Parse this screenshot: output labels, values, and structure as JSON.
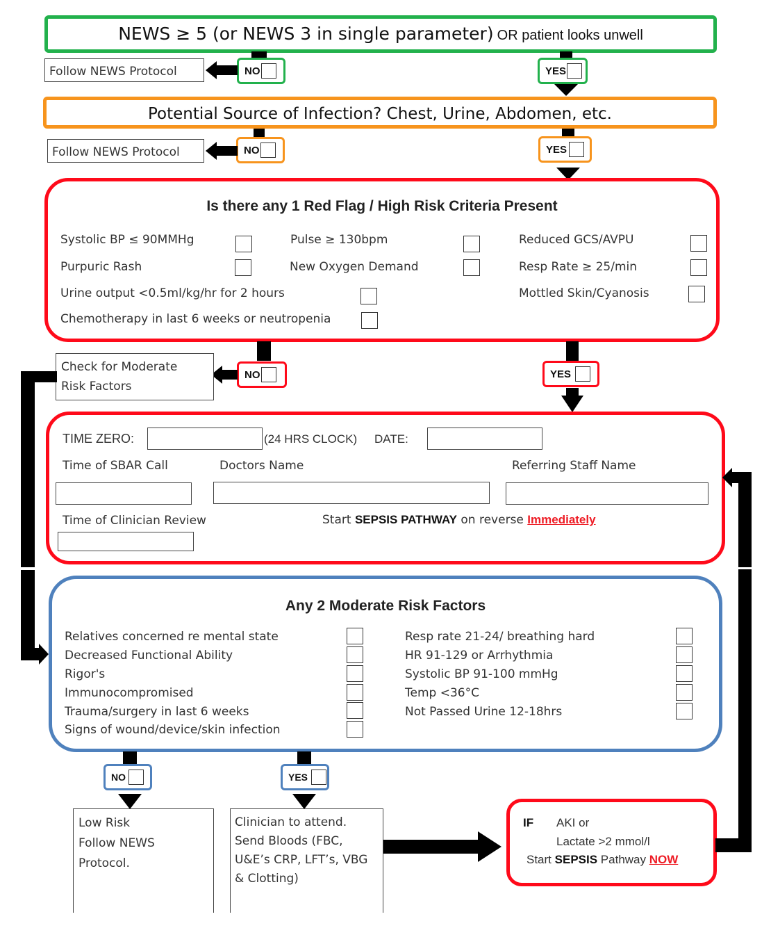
{
  "step1": {
    "title_main": "NEWS ≥ 5 (or NEWS 3 in single parameter)",
    "title_suffix": "OR patient looks unwell",
    "no_label": "NO",
    "yes_label": "YES",
    "no_action": "Follow NEWS Protocol"
  },
  "step2": {
    "title": "Potential Source of Infection? Chest, Urine, Abdomen, etc.",
    "no_label": "NO",
    "yes_label": "YES",
    "no_action": "Follow NEWS Protocol"
  },
  "red_flag": {
    "title": "Is there any 1 Red Flag / High Risk Criteria Present",
    "criteria": [
      "Systolic BP ≤ 90MMHg",
      "Pulse ≥ 130bpm",
      "Reduced GCS/AVPU",
      "Purpuric Rash",
      "New Oxygen Demand",
      "Resp Rate ≥ 25/min",
      "Urine output <0.5ml/kg/hr for 2 hours",
      "Mottled Skin/Cyanosis",
      "Chemotherapy in last 6 weeks or neutropenia"
    ],
    "no_label": "NO",
    "yes_label": "YES",
    "no_action_line1": "Check for Moderate",
    "no_action_line2": "Risk Factors"
  },
  "time_zero": {
    "time_zero_label": "TIME ZERO:",
    "clock_note": "(24 HRS CLOCK)",
    "date_label": "DATE:",
    "sbar_label": "Time of SBAR Call",
    "doctors_label": "Doctors Name",
    "referring_label": "Referring Staff Name",
    "clinician_review_label": "Time of Clinician Review",
    "start_prefix": "Start",
    "start_bold": "SEPSIS PATHWAY",
    "start_mid": "on reverse",
    "start_emphasis": "Immediately",
    "values": {
      "time_zero": "",
      "date": "",
      "sbar_time": "",
      "doctors_name": "",
      "referring_staff": "",
      "clinician_review_time": ""
    }
  },
  "moderate": {
    "title": "Any 2 Moderate Risk Factors",
    "left_factors": [
      "Relatives concerned re mental state",
      "Decreased Functional Ability",
      "Rigor's",
      "Immunocompromised",
      "Trauma/surgery in last 6 weeks",
      "Signs of wound/device/skin infection"
    ],
    "right_factors": [
      "Resp rate 21-24/ breathing hard",
      "HR 91-129 or Arrhythmia",
      "Systolic BP 91-100 mmHg",
      "Temp <36°C",
      "Not Passed Urine 12-18hrs"
    ],
    "no_label": "NO",
    "yes_label": "YES"
  },
  "low_risk": {
    "lines": [
      "Low Risk",
      "Follow NEWS",
      "Protocol."
    ]
  },
  "clinician": {
    "lines": [
      "Clinician to attend.",
      "Send Bloods (FBC,",
      "U&E’s CRP, LFT’s, VBG",
      "& Clotting)"
    ]
  },
  "if_box": {
    "if_label": "IF",
    "cond1": "AKI or",
    "cond2": "Lactate >2 mmol/l",
    "start_prefix": "Start",
    "start_bold": "SEPSIS",
    "start_mid": "Pathway",
    "start_emphasis": "NOW"
  },
  "colors": {
    "step1_border": "#22b14c",
    "step2_border": "#f7941d",
    "red_flag_border": "#ff0a1a",
    "moderate_border": "#4f81bd",
    "emphasis_text": "#ee1c25"
  }
}
